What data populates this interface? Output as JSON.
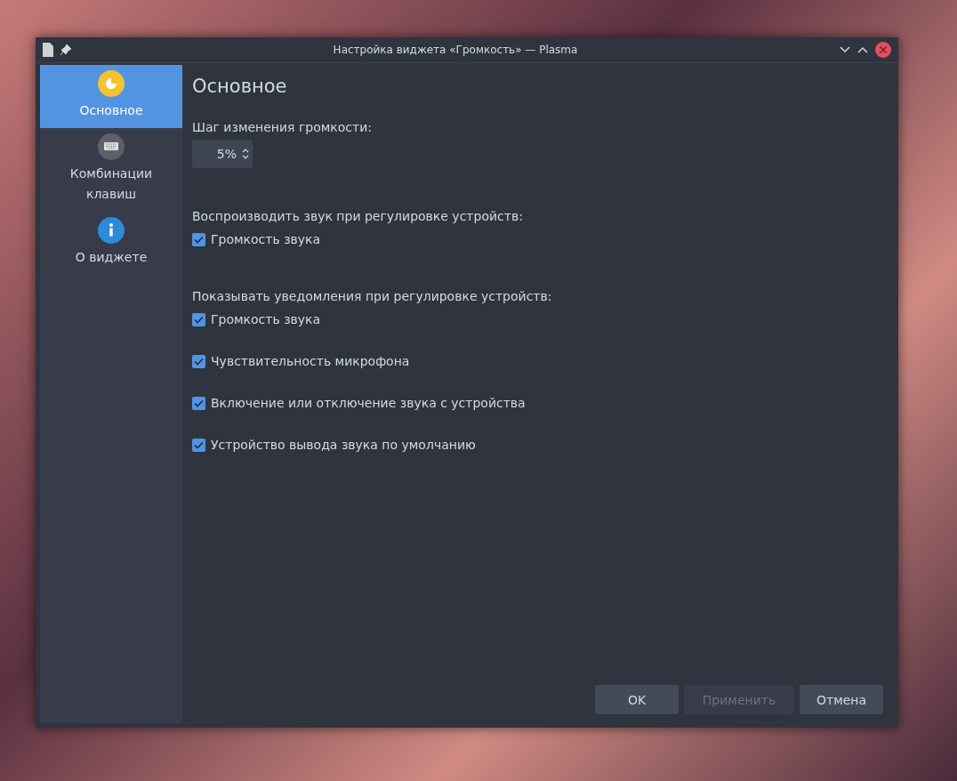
{
  "window": {
    "title": "Настройка виджета «Громкость» — Plasma"
  },
  "sidebar": {
    "items": [
      {
        "label": "Основное",
        "kind": "general",
        "selected": true
      },
      {
        "label": "Комбинации клавиш",
        "kind": "keyboard",
        "selected": false
      },
      {
        "label": "О виджете",
        "kind": "info",
        "selected": false
      }
    ]
  },
  "page": {
    "heading": "Основное",
    "step": {
      "label": "Шаг изменения громкости:",
      "value": "5%"
    },
    "groups": [
      {
        "label": "Воспроизводить звук при регулировке устройств:",
        "options": [
          {
            "label": "Громкость звука",
            "checked": true
          }
        ]
      },
      {
        "label": "Показывать уведомления при регулировке устройств:",
        "options": [
          {
            "label": "Громкость звука",
            "checked": true
          },
          {
            "label": "Чувствительность микрофона",
            "checked": true
          },
          {
            "label": "Включение или отключение звука с устройства",
            "checked": true
          },
          {
            "label": "Устройство вывода звука по умолчанию",
            "checked": true
          }
        ]
      }
    ]
  },
  "buttons": [
    {
      "label": "OK",
      "disabled": false
    },
    {
      "label": "Применить",
      "disabled": true
    },
    {
      "label": "Отмена",
      "disabled": false
    }
  ]
}
